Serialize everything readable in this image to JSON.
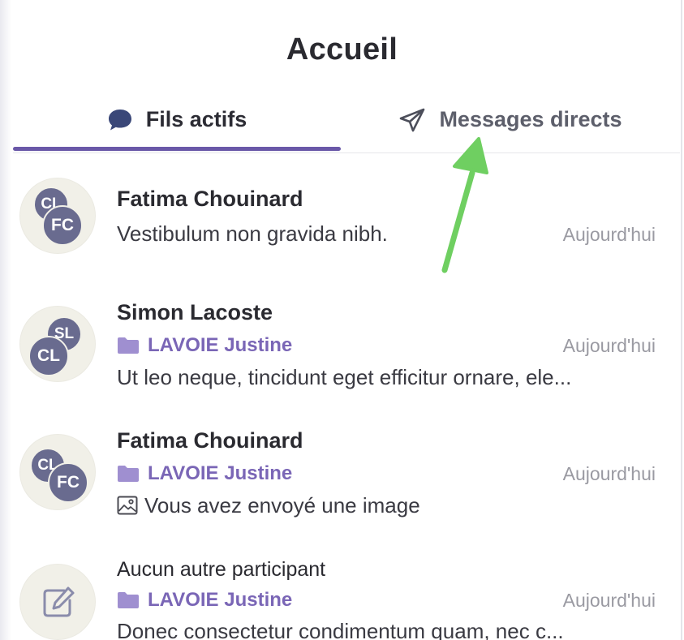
{
  "header": {
    "title": "Accueil"
  },
  "tabs": [
    {
      "label": "Fils actifs",
      "icon": "chat-bubble-icon",
      "active": true
    },
    {
      "label": "Messages directs",
      "icon": "paper-plane-icon",
      "active": false
    }
  ],
  "colors": {
    "accent": "#6a58a8",
    "folder": "#7a66b6",
    "avatar": "#696b8f",
    "annotation_arrow": "#6fcf61"
  },
  "threads": [
    {
      "avatars": [
        "CL",
        "FC"
      ],
      "name": "Fatima Chouinard",
      "folder": "",
      "preview": "Vestibulum non gravida nibh.",
      "time": "Aujourd'hui"
    },
    {
      "avatars": [
        "SL",
        "CL"
      ],
      "name": "Simon Lacoste",
      "folder": "LAVOIE Justine",
      "preview": "Ut leo neque, tincidunt eget efficitur ornare, ele...",
      "time": "Aujourd'hui"
    },
    {
      "avatars": [
        "CL",
        "FC"
      ],
      "name": "Fatima Chouinard",
      "folder": "LAVOIE Justine",
      "preview": "Vous avez envoyé une image",
      "preview_icon": "image-icon",
      "time": "Aujourd'hui"
    },
    {
      "avatars": [],
      "avatar_icon": "edit-icon",
      "name": "Aucun autre participant",
      "folder": "LAVOIE Justine",
      "preview": "Donec consectetur condimentum quam, nec c...",
      "time": "Aujourd'hui"
    }
  ]
}
